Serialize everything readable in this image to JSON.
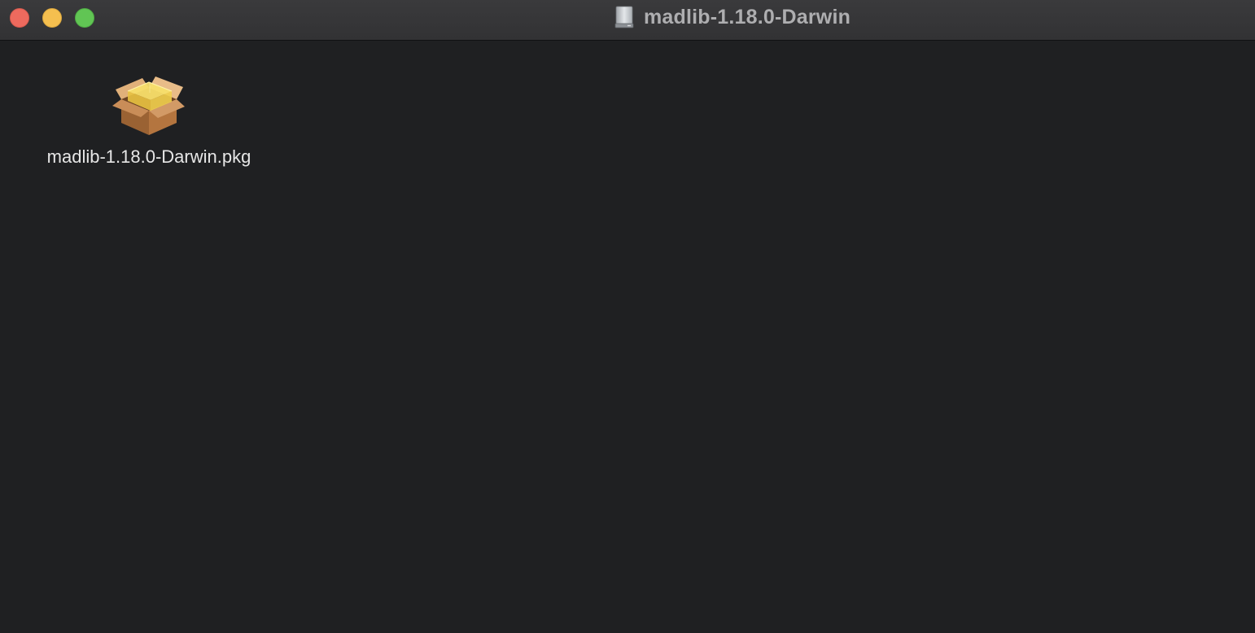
{
  "window": {
    "title": "madlib-1.18.0-Darwin",
    "title_icon": "disk-image-icon",
    "buttons": {
      "close": "close-button",
      "minimize": "minimize-button",
      "zoom": "zoom-button"
    }
  },
  "files": [
    {
      "name": "madlib-1.18.0-Darwin.pkg",
      "icon": "package-icon"
    }
  ],
  "colors": {
    "background": "#1f2022",
    "titlebar": "#3a3a3c",
    "close": "#ed6a5e",
    "minimize": "#f5bf4f",
    "zoom": "#61c554"
  }
}
